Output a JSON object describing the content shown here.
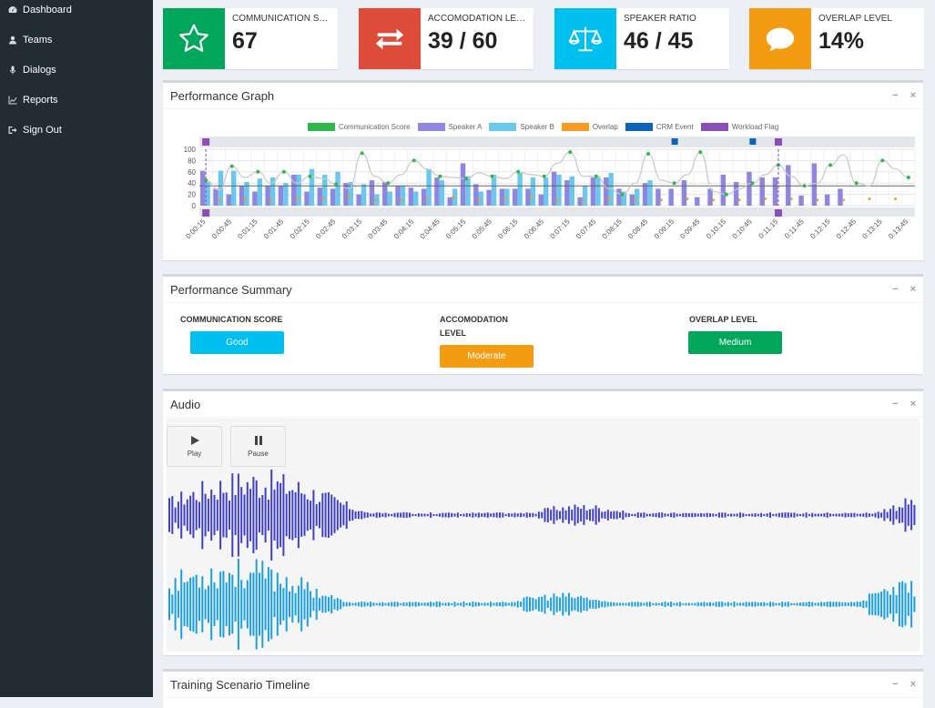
{
  "sidebar": {
    "items": [
      {
        "label": "Dashboard",
        "icon": "dashboard-icon"
      },
      {
        "label": "Teams",
        "icon": "user-icon"
      },
      {
        "label": "Dialogs",
        "icon": "microphone-icon"
      },
      {
        "label": "Reports",
        "icon": "line-chart-icon"
      },
      {
        "label": "Sign Out",
        "icon": "sign-out-icon"
      }
    ]
  },
  "stats": [
    {
      "label": "COMMUNICATION SCORE",
      "value": "67",
      "color": "#00a65a",
      "icon": "star-icon"
    },
    {
      "label": "ACCOMODATION LEVEL",
      "value": "39 / 60",
      "color": "#dd4b39",
      "icon": "exchange-icon"
    },
    {
      "label": "SPEAKER RATIO",
      "value": "46 / 45",
      "color": "#00c0ef",
      "icon": "balance-scale-icon"
    },
    {
      "label": "OVERLAP LEVEL",
      "value": "14%",
      "color": "#f39c12",
      "icon": "comment-icon"
    }
  ],
  "graph": {
    "title": "Performance Graph",
    "legend": [
      {
        "name": "Communication Score",
        "color": "#2eb84b"
      },
      {
        "name": "Speaker A",
        "color": "#8f86e0"
      },
      {
        "name": "Speaker B",
        "color": "#69c8ec"
      },
      {
        "name": "Overlap",
        "color": "#f59a23"
      },
      {
        "name": "CRM Event",
        "color": "#0d64b8"
      },
      {
        "name": "Workload Flag",
        "color": "#8a4fb5"
      }
    ]
  },
  "chart_data": {
    "type": "bar",
    "categories": [
      "0:00:15",
      "0:00:30",
      "0:00:45",
      "0:01:00",
      "0:01:15",
      "0:01:30",
      "0:01:45",
      "0:02:00",
      "0:02:15",
      "0:02:30",
      "0:02:45",
      "0:03:00",
      "0:03:15",
      "0:03:30",
      "0:03:45",
      "0:04:00",
      "0:04:15",
      "0:04:30",
      "0:04:45",
      "0:05:00",
      "0:05:15",
      "0:05:30",
      "0:05:45",
      "0:06:00",
      "0:06:15",
      "0:06:30",
      "0:06:45",
      "0:07:00",
      "0:07:15",
      "0:07:30",
      "0:07:45",
      "0:08:00",
      "0:08:15",
      "0:08:30",
      "0:08:45",
      "0:09:00",
      "0:09:15",
      "0:09:30",
      "0:09:45",
      "0:10:00",
      "0:10:15",
      "0:10:30",
      "0:10:45",
      "0:11:00",
      "0:11:15",
      "0:11:30",
      "0:11:45",
      "0:12:00",
      "0:12:15",
      "0:12:30",
      "0:12:45",
      "0:13:00",
      "0:13:15",
      "0:13:30",
      "0:13:45"
    ],
    "tick_labels": [
      "0:00:15",
      "0:00:45",
      "0:01:15",
      "0:01:45",
      "0:02:15",
      "0:02:45",
      "0:03:15",
      "0:03:45",
      "0:04:15",
      "0:04:45",
      "0:05:15",
      "0:05:45",
      "0:06:15",
      "0:06:45",
      "0:07:15",
      "0:07:45",
      "0:08:15",
      "0:08:45",
      "0:09:15",
      "0:09:45",
      "0:10:15",
      "0:10:45",
      "0:11:15",
      "0:11:45",
      "0:12:15",
      "0:12:45",
      "0:13:15",
      "0:13:45"
    ],
    "series": [
      {
        "name": "Speaker A",
        "type": "bar",
        "values": [
          62,
          30,
          20,
          35,
          25,
          35,
          35,
          55,
          25,
          32,
          30,
          40,
          20,
          45,
          42,
          35,
          32,
          30,
          50,
          15,
          75,
          38,
          28,
          30,
          30,
          30,
          20,
          60,
          45,
          15,
          50,
          50,
          30,
          20,
          40,
          30,
          30,
          45,
          15,
          30,
          55,
          42,
          60,
          50,
          50,
          72,
          18,
          75,
          20,
          30,
          0,
          0,
          0,
          0,
          0
        ]
      },
      {
        "name": "Speaker B",
        "type": "bar",
        "values": [
          42,
          62,
          62,
          42,
          48,
          50,
          40,
          55,
          65,
          55,
          60,
          42,
          38,
          20,
          25,
          35,
          25,
          65,
          45,
          30,
          52,
          25,
          55,
          30,
          58,
          50,
          50,
          55,
          52,
          35,
          52,
          58,
          25,
          30,
          45,
          0,
          0,
          0,
          0,
          0,
          0,
          0,
          0,
          0,
          0,
          0,
          0,
          0,
          0,
          0,
          0,
          0,
          0,
          0,
          0
        ]
      },
      {
        "name": "Communication Score",
        "type": "line",
        "values": [
          45,
          28,
          70,
          50,
          60,
          40,
          60,
          40,
          52,
          48,
          38,
          30,
          93,
          52,
          40,
          55,
          80,
          65,
          52,
          50,
          48,
          58,
          52,
          48,
          60,
          55,
          52,
          75,
          95,
          52,
          52,
          30,
          20,
          40,
          92,
          45,
          40,
          55,
          95,
          25,
          20,
          30,
          40,
          55,
          72,
          52,
          35,
          40,
          72,
          90,
          40,
          35,
          80,
          65,
          50
        ]
      },
      {
        "name": "Overlap",
        "type": "line",
        "values": [
          10,
          10,
          12,
          12,
          15,
          10,
          10,
          12,
          10,
          12,
          10,
          15,
          10,
          10,
          12,
          10,
          10,
          12,
          10,
          15,
          12,
          10,
          10,
          12,
          10,
          15,
          10,
          10,
          12,
          10,
          10,
          12,
          10,
          10,
          12,
          10,
          10,
          12,
          10,
          10,
          12,
          10,
          10,
          12,
          10,
          12,
          10,
          10,
          12,
          10,
          10,
          12,
          10,
          12,
          10
        ]
      }
    ],
    "threshold": 35,
    "crm_events": [
      "0:09:15",
      "0:10:45"
    ],
    "workload_flags": [
      "0:00:15",
      "0:11:15"
    ],
    "ylim": [
      0,
      100
    ],
    "yticks": [
      0,
      20,
      40,
      60,
      80,
      100
    ],
    "grid": true,
    "legend_position": "top"
  },
  "summary": {
    "title": "Performance Summary",
    "items": [
      {
        "label": "COMMUNICATION SCORE",
        "value": "Good",
        "color": "#00c0ef"
      },
      {
        "label_line1": "ACCOMODATION",
        "label_line2": "LEVEL",
        "value": "Moderate",
        "color": "#f39c12"
      },
      {
        "label": "OVERLAP LEVEL",
        "value": "Medium",
        "color": "#00a65a"
      }
    ]
  },
  "audio": {
    "title": "Audio",
    "play_label": "Play",
    "pause_label": "Pause",
    "track_a_color": "#3f3fc7",
    "track_b_color": "#1a9fe0"
  },
  "timeline": {
    "title": "Training Scenario Timeline"
  },
  "tools": {
    "minimize": "−",
    "close": "×"
  }
}
